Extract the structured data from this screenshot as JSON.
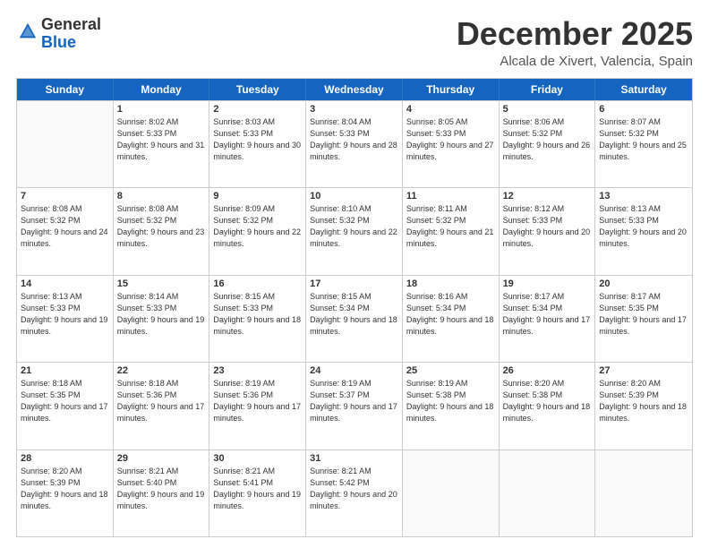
{
  "logo": {
    "general": "General",
    "blue": "Blue"
  },
  "title": {
    "month": "December 2025",
    "location": "Alcala de Xivert, Valencia, Spain"
  },
  "header_days": [
    "Sunday",
    "Monday",
    "Tuesday",
    "Wednesday",
    "Thursday",
    "Friday",
    "Saturday"
  ],
  "weeks": [
    [
      {
        "day": "",
        "sunrise": "",
        "sunset": "",
        "daylight": ""
      },
      {
        "day": "1",
        "sunrise": "Sunrise: 8:02 AM",
        "sunset": "Sunset: 5:33 PM",
        "daylight": "Daylight: 9 hours and 31 minutes."
      },
      {
        "day": "2",
        "sunrise": "Sunrise: 8:03 AM",
        "sunset": "Sunset: 5:33 PM",
        "daylight": "Daylight: 9 hours and 30 minutes."
      },
      {
        "day": "3",
        "sunrise": "Sunrise: 8:04 AM",
        "sunset": "Sunset: 5:33 PM",
        "daylight": "Daylight: 9 hours and 28 minutes."
      },
      {
        "day": "4",
        "sunrise": "Sunrise: 8:05 AM",
        "sunset": "Sunset: 5:33 PM",
        "daylight": "Daylight: 9 hours and 27 minutes."
      },
      {
        "day": "5",
        "sunrise": "Sunrise: 8:06 AM",
        "sunset": "Sunset: 5:32 PM",
        "daylight": "Daylight: 9 hours and 26 minutes."
      },
      {
        "day": "6",
        "sunrise": "Sunrise: 8:07 AM",
        "sunset": "Sunset: 5:32 PM",
        "daylight": "Daylight: 9 hours and 25 minutes."
      }
    ],
    [
      {
        "day": "7",
        "sunrise": "Sunrise: 8:08 AM",
        "sunset": "Sunset: 5:32 PM",
        "daylight": "Daylight: 9 hours and 24 minutes."
      },
      {
        "day": "8",
        "sunrise": "Sunrise: 8:08 AM",
        "sunset": "Sunset: 5:32 PM",
        "daylight": "Daylight: 9 hours and 23 minutes."
      },
      {
        "day": "9",
        "sunrise": "Sunrise: 8:09 AM",
        "sunset": "Sunset: 5:32 PM",
        "daylight": "Daylight: 9 hours and 22 minutes."
      },
      {
        "day": "10",
        "sunrise": "Sunrise: 8:10 AM",
        "sunset": "Sunset: 5:32 PM",
        "daylight": "Daylight: 9 hours and 22 minutes."
      },
      {
        "day": "11",
        "sunrise": "Sunrise: 8:11 AM",
        "sunset": "Sunset: 5:32 PM",
        "daylight": "Daylight: 9 hours and 21 minutes."
      },
      {
        "day": "12",
        "sunrise": "Sunrise: 8:12 AM",
        "sunset": "Sunset: 5:33 PM",
        "daylight": "Daylight: 9 hours and 20 minutes."
      },
      {
        "day": "13",
        "sunrise": "Sunrise: 8:13 AM",
        "sunset": "Sunset: 5:33 PM",
        "daylight": "Daylight: 9 hours and 20 minutes."
      }
    ],
    [
      {
        "day": "14",
        "sunrise": "Sunrise: 8:13 AM",
        "sunset": "Sunset: 5:33 PM",
        "daylight": "Daylight: 9 hours and 19 minutes."
      },
      {
        "day": "15",
        "sunrise": "Sunrise: 8:14 AM",
        "sunset": "Sunset: 5:33 PM",
        "daylight": "Daylight: 9 hours and 19 minutes."
      },
      {
        "day": "16",
        "sunrise": "Sunrise: 8:15 AM",
        "sunset": "Sunset: 5:33 PM",
        "daylight": "Daylight: 9 hours and 18 minutes."
      },
      {
        "day": "17",
        "sunrise": "Sunrise: 8:15 AM",
        "sunset": "Sunset: 5:34 PM",
        "daylight": "Daylight: 9 hours and 18 minutes."
      },
      {
        "day": "18",
        "sunrise": "Sunrise: 8:16 AM",
        "sunset": "Sunset: 5:34 PM",
        "daylight": "Daylight: 9 hours and 18 minutes."
      },
      {
        "day": "19",
        "sunrise": "Sunrise: 8:17 AM",
        "sunset": "Sunset: 5:34 PM",
        "daylight": "Daylight: 9 hours and 17 minutes."
      },
      {
        "day": "20",
        "sunrise": "Sunrise: 8:17 AM",
        "sunset": "Sunset: 5:35 PM",
        "daylight": "Daylight: 9 hours and 17 minutes."
      }
    ],
    [
      {
        "day": "21",
        "sunrise": "Sunrise: 8:18 AM",
        "sunset": "Sunset: 5:35 PM",
        "daylight": "Daylight: 9 hours and 17 minutes."
      },
      {
        "day": "22",
        "sunrise": "Sunrise: 8:18 AM",
        "sunset": "Sunset: 5:36 PM",
        "daylight": "Daylight: 9 hours and 17 minutes."
      },
      {
        "day": "23",
        "sunrise": "Sunrise: 8:19 AM",
        "sunset": "Sunset: 5:36 PM",
        "daylight": "Daylight: 9 hours and 17 minutes."
      },
      {
        "day": "24",
        "sunrise": "Sunrise: 8:19 AM",
        "sunset": "Sunset: 5:37 PM",
        "daylight": "Daylight: 9 hours and 17 minutes."
      },
      {
        "day": "25",
        "sunrise": "Sunrise: 8:19 AM",
        "sunset": "Sunset: 5:38 PM",
        "daylight": "Daylight: 9 hours and 18 minutes."
      },
      {
        "day": "26",
        "sunrise": "Sunrise: 8:20 AM",
        "sunset": "Sunset: 5:38 PM",
        "daylight": "Daylight: 9 hours and 18 minutes."
      },
      {
        "day": "27",
        "sunrise": "Sunrise: 8:20 AM",
        "sunset": "Sunset: 5:39 PM",
        "daylight": "Daylight: 9 hours and 18 minutes."
      }
    ],
    [
      {
        "day": "28",
        "sunrise": "Sunrise: 8:20 AM",
        "sunset": "Sunset: 5:39 PM",
        "daylight": "Daylight: 9 hours and 18 minutes."
      },
      {
        "day": "29",
        "sunrise": "Sunrise: 8:21 AM",
        "sunset": "Sunset: 5:40 PM",
        "daylight": "Daylight: 9 hours and 19 minutes."
      },
      {
        "day": "30",
        "sunrise": "Sunrise: 8:21 AM",
        "sunset": "Sunset: 5:41 PM",
        "daylight": "Daylight: 9 hours and 19 minutes."
      },
      {
        "day": "31",
        "sunrise": "Sunrise: 8:21 AM",
        "sunset": "Sunset: 5:42 PM",
        "daylight": "Daylight: 9 hours and 20 minutes."
      },
      {
        "day": "",
        "sunrise": "",
        "sunset": "",
        "daylight": ""
      },
      {
        "day": "",
        "sunrise": "",
        "sunset": "",
        "daylight": ""
      },
      {
        "day": "",
        "sunrise": "",
        "sunset": "",
        "daylight": ""
      }
    ]
  ]
}
